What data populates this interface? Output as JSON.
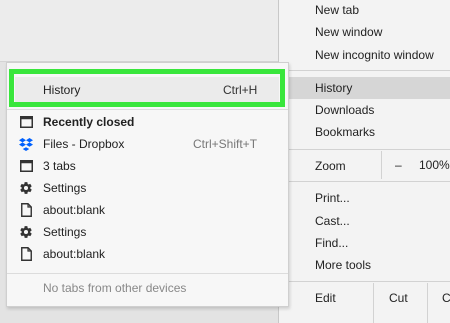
{
  "main_menu": {
    "items": [
      {
        "label": "New tab"
      },
      {
        "label": "New window"
      },
      {
        "label": "New incognito window"
      },
      {
        "label": "History"
      },
      {
        "label": "Downloads"
      },
      {
        "label": "Bookmarks"
      },
      {
        "label": "Print..."
      },
      {
        "label": "Cast..."
      },
      {
        "label": "Find..."
      },
      {
        "label": "More tools"
      }
    ],
    "zoom": {
      "label": "Zoom",
      "minus": "–",
      "value": "100%"
    },
    "edit": {
      "label": "Edit",
      "cut": "Cut",
      "copy_partial": "C"
    }
  },
  "history_submenu": {
    "history": {
      "label": "History",
      "shortcut": "Ctrl+H"
    },
    "recently_closed": "Recently closed",
    "entries": [
      {
        "label": "Files - Dropbox",
        "shortcut": "Ctrl+Shift+T",
        "icon": "dropbox-icon"
      },
      {
        "label": "3 tabs",
        "icon": "window-icon"
      },
      {
        "label": "Settings",
        "icon": "gear-icon"
      },
      {
        "label": "about:blank",
        "icon": "page-icon"
      },
      {
        "label": "Settings",
        "icon": "gear-icon"
      },
      {
        "label": "about:blank",
        "icon": "page-icon"
      }
    ],
    "no_tabs": "No tabs from other devices"
  },
  "colors": {
    "highlight_box": "#39e63c",
    "dropbox_blue": "#0061fe"
  }
}
